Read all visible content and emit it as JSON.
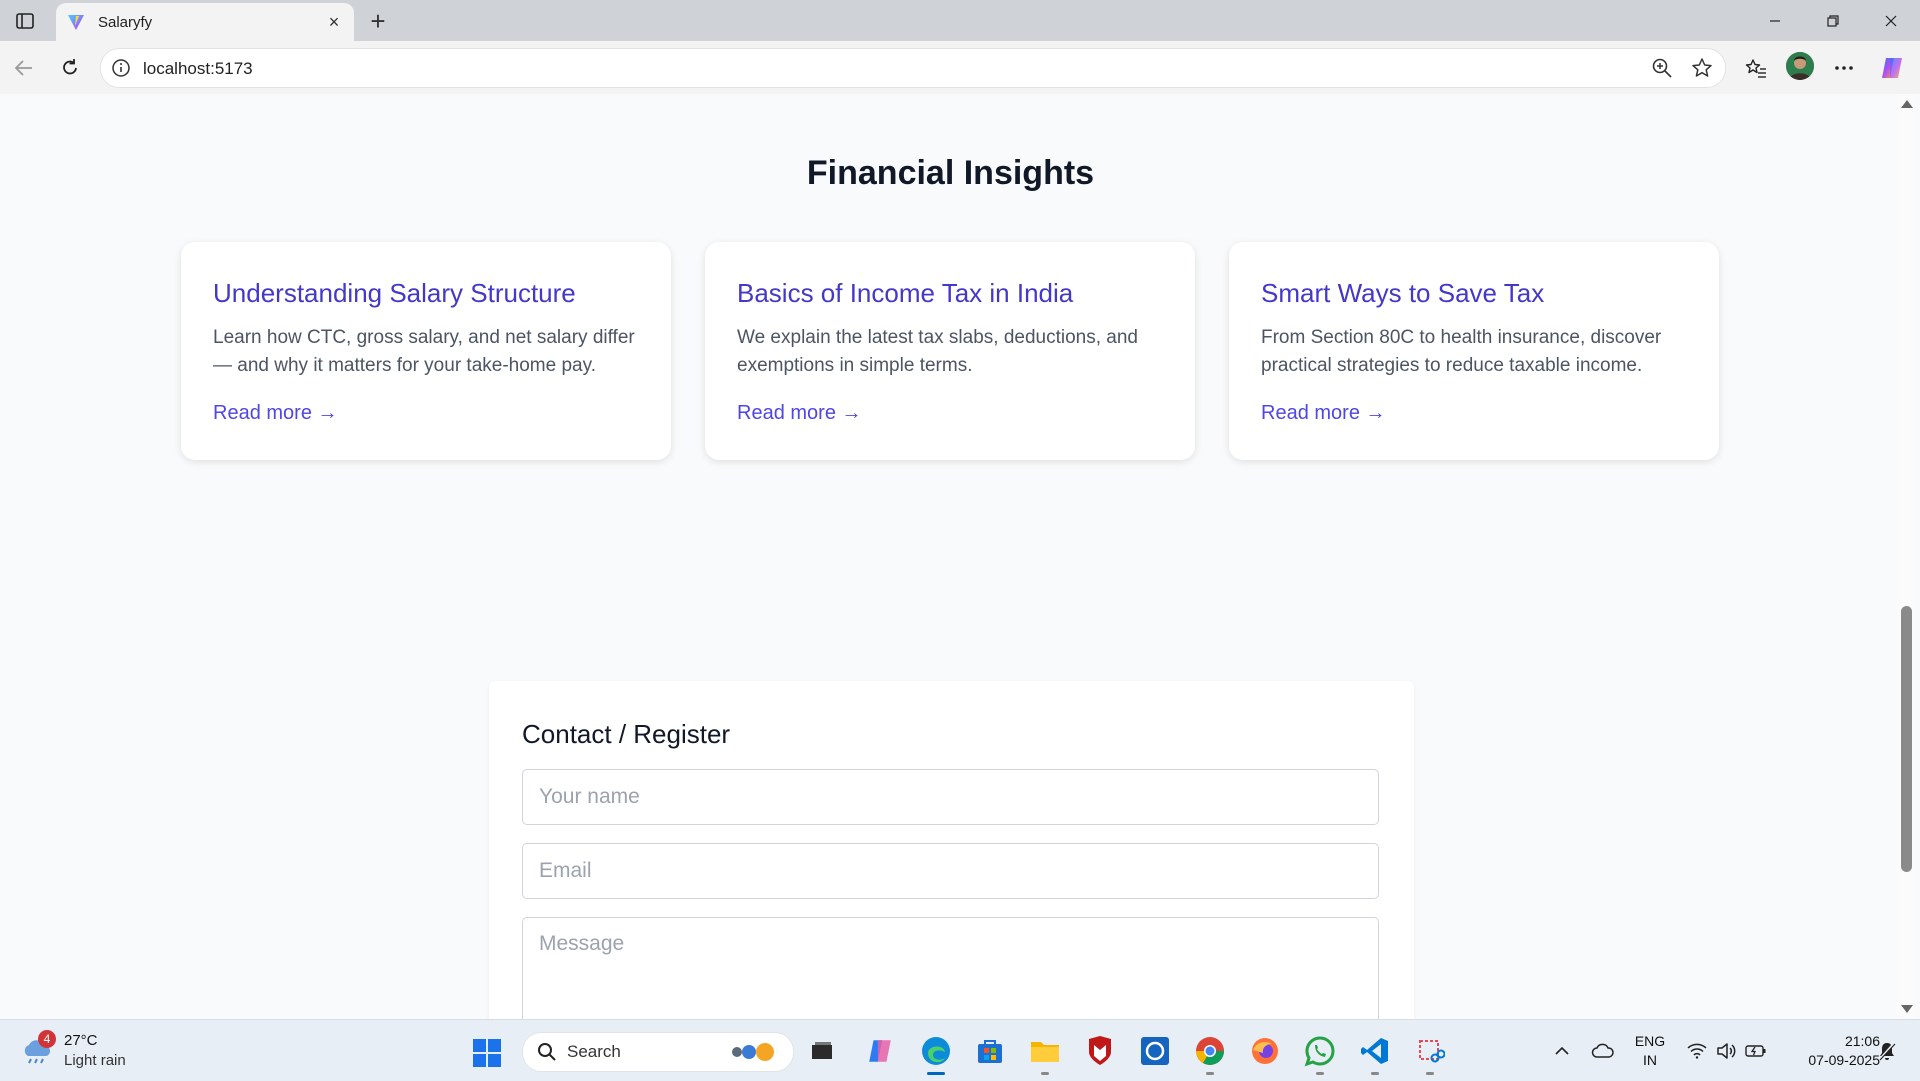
{
  "browser": {
    "tab_title": "Salaryfy",
    "url": "localhost:5173",
    "new_tab_symbol": "+",
    "close_symbol": "×"
  },
  "page": {
    "section_title": "Financial Insights",
    "cards": [
      {
        "title": "Understanding Salary Structure",
        "description": "Learn how CTC, gross salary, and net salary differ — and why it matters for your take-home pay.",
        "link": "Read more →"
      },
      {
        "title": "Basics of Income Tax in India",
        "description": "We explain the latest tax slabs, deductions, and exemptions in simple terms.",
        "link": "Read more →"
      },
      {
        "title": "Smart Ways to Save Tax",
        "description": "From Section 80C to health insurance, discover practical strategies to reduce taxable income.",
        "link": "Read more →"
      }
    ],
    "contact": {
      "title": "Contact / Register",
      "name_placeholder": "Your name",
      "email_placeholder": "Email",
      "message_placeholder": "Message"
    }
  },
  "taskbar": {
    "weather": {
      "badge": "4",
      "temp": "27°C",
      "desc": "Light rain"
    },
    "search_label": "Search",
    "lang_line1": "ENG",
    "lang_line2": "IN",
    "time": "21:06",
    "date": "07-09-2025"
  },
  "colors": {
    "card_title": "#4338ca",
    "link": "#4f46e5",
    "page_bg": "#f9fafb"
  }
}
